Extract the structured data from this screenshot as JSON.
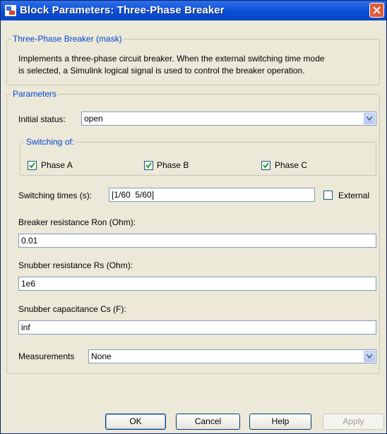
{
  "window": {
    "title": "Block Parameters: Three-Phase Breaker"
  },
  "mask": {
    "legend": "Three-Phase Breaker (mask)",
    "description_line1": "Implements a three-phase circuit breaker. When the external switching time mode",
    "description_line2": "is selected, a Simulink logical signal is used to control the breaker operation."
  },
  "parameters": {
    "legend": "Parameters",
    "initial_status_label": "Initial status:",
    "initial_status_value": "open",
    "switching_legend": "Switching of:",
    "phases": [
      {
        "label": "Phase A",
        "checked": true
      },
      {
        "label": "Phase B",
        "checked": true
      },
      {
        "label": "Phase C",
        "checked": true
      }
    ],
    "switching_times_label": "Switching times (s):",
    "switching_times_value": "[1/60  5/60]",
    "external_label": "External",
    "external_checked": false,
    "ron_label": "Breaker resistance Ron (Ohm):",
    "ron_value": "0.01",
    "rs_label": "Snubber resistance Rs (Ohm):",
    "rs_value": "1e6",
    "cs_label": "Snubber capacitance Cs (F):",
    "cs_value": "inf",
    "measurements_label": "Measurements",
    "measurements_value": "None"
  },
  "buttons": {
    "ok": "OK",
    "cancel": "Cancel",
    "help": "Help",
    "apply": "Apply"
  },
  "icons": {
    "app": "block-icon",
    "close": "close-icon",
    "dropdown": "chevron-down-icon",
    "check": "checkmark-icon"
  },
  "colors": {
    "titlebar": "#0a4fd6",
    "close": "#e15a35",
    "legend_text": "#0046d5",
    "background": "#ece9d8"
  }
}
